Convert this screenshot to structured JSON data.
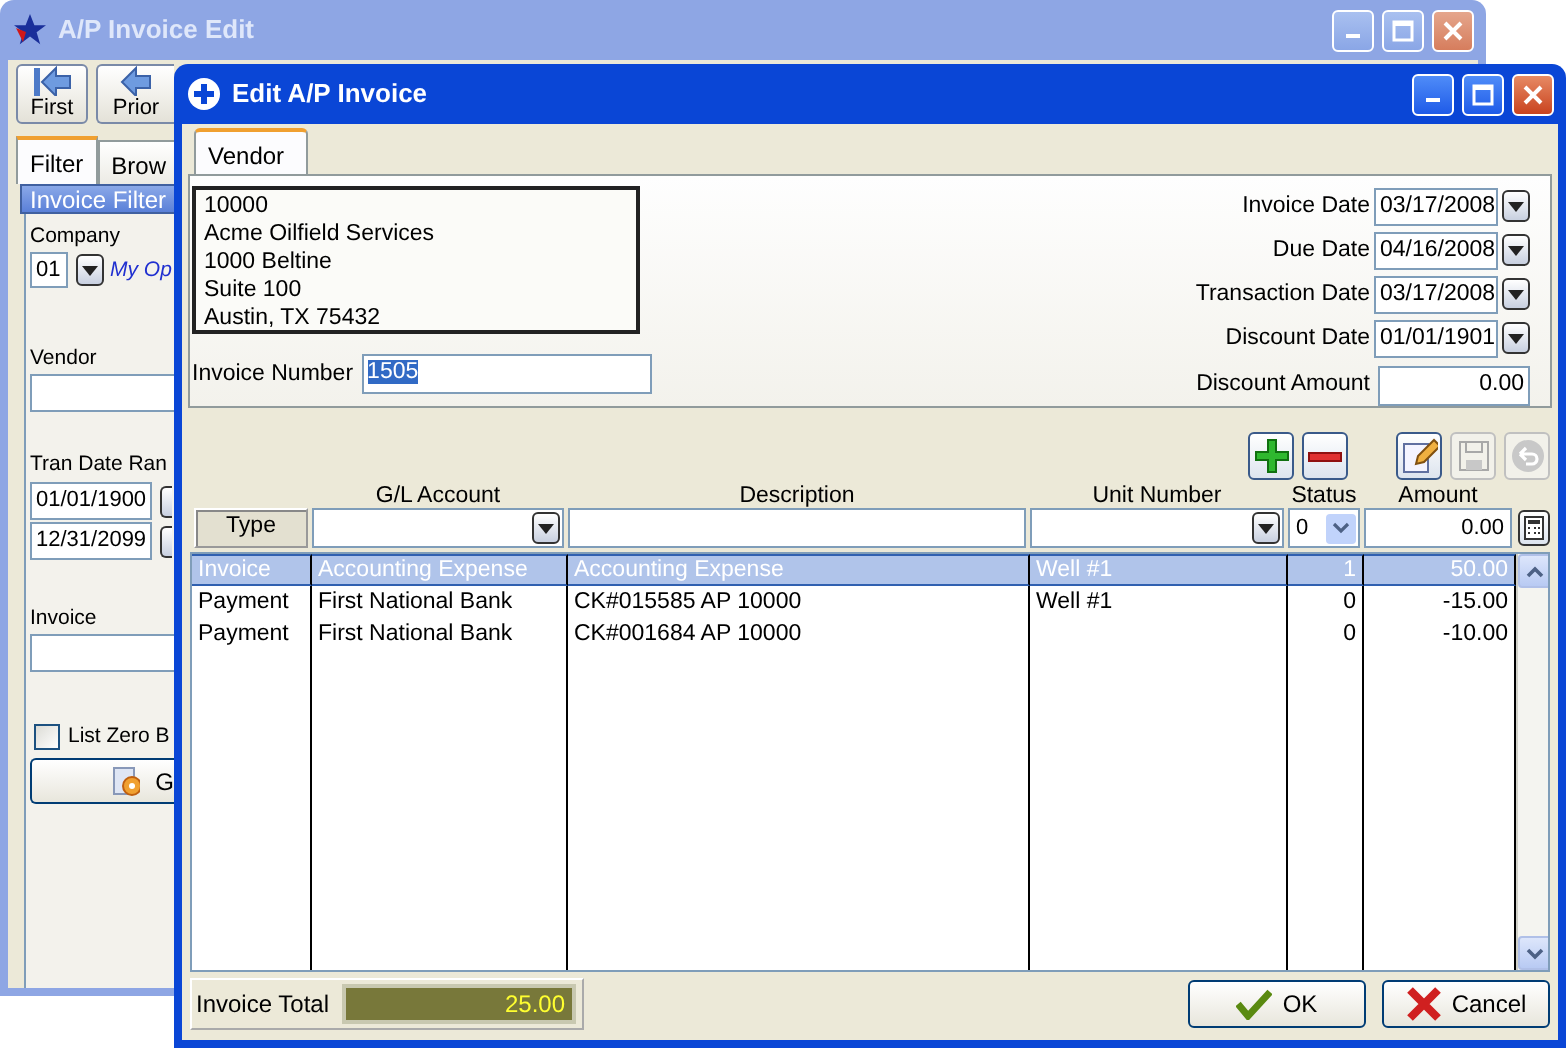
{
  "back_window": {
    "title": "A/P Invoice Edit",
    "toolbar": [
      {
        "label": "First",
        "kind": "first"
      },
      {
        "label": "Prior",
        "kind": "prior"
      }
    ],
    "tabs": [
      {
        "label": "Filter",
        "selected": true
      },
      {
        "label": "Brow",
        "selected": false
      }
    ],
    "section_title": "Invoice Filter",
    "company": {
      "label": "Company",
      "value": "01",
      "name": "My Op"
    },
    "vendor": {
      "label": "Vendor"
    },
    "tran_date_range": {
      "label": "Tran Date Ran",
      "from": "01/01/1900",
      "to": "12/31/2099"
    },
    "invoice": {
      "label": "Invoice"
    },
    "list_zero": {
      "label": "List Zero B",
      "checked": false
    },
    "go_button": {
      "label": "G"
    }
  },
  "front_window": {
    "title": "Edit A/P Invoice",
    "tabs": [
      {
        "label": "Vendor",
        "selected": true
      }
    ],
    "vendor_address": [
      "10000",
      "Acme Oilfield Services",
      "1000 Beltine",
      "Suite 100",
      "Austin, TX 75432"
    ],
    "invoice_number": {
      "label": "Invoice Number",
      "value": "1505",
      "selected": true
    },
    "dates": [
      {
        "label": "Invoice Date",
        "value": "03/17/2008",
        "kind": "date"
      },
      {
        "label": "Due Date",
        "value": "04/16/2008",
        "kind": "date"
      },
      {
        "label": "Transaction Date",
        "value": "03/17/2008",
        "kind": "date"
      },
      {
        "label": "Discount Date",
        "value": "01/01/1901",
        "kind": "date"
      },
      {
        "label": "Discount Amount",
        "value": "0.00",
        "kind": "amount"
      }
    ],
    "toolbar": [
      {
        "kind": "add",
        "disabled": false
      },
      {
        "kind": "remove",
        "disabled": false
      },
      {
        "kind": "edit",
        "disabled": false
      },
      {
        "kind": "save",
        "disabled": true
      },
      {
        "kind": "undo",
        "disabled": true
      }
    ],
    "grid": {
      "columns": [
        "G/L Account",
        "Description",
        "Unit Number",
        "Status",
        "Amount"
      ],
      "type_button": "Type",
      "filter": {
        "status": "0",
        "amount": "0.00"
      },
      "rows": [
        {
          "type": "Invoice",
          "gl_account": "Accounting Expense",
          "description": "Accounting Expense",
          "unit_number": "Well #1",
          "status": "1",
          "amount": "50.00",
          "selected": true
        },
        {
          "type": "Payment",
          "gl_account": "First National Bank",
          "description": "CK#015585 AP 10000",
          "unit_number": "Well #1",
          "status": "0",
          "amount": "-15.00",
          "selected": false
        },
        {
          "type": "Payment",
          "gl_account": "First National Bank",
          "description": "CK#001684 AP 10000",
          "status": "0",
          "amount": "-10.00",
          "selected": false
        }
      ]
    },
    "total": {
      "label": "Invoice Total",
      "value": "25.00"
    },
    "buttons": [
      {
        "kind": "ok",
        "label": "OK"
      },
      {
        "kind": "cancel",
        "label": "Cancel"
      }
    ]
  }
}
